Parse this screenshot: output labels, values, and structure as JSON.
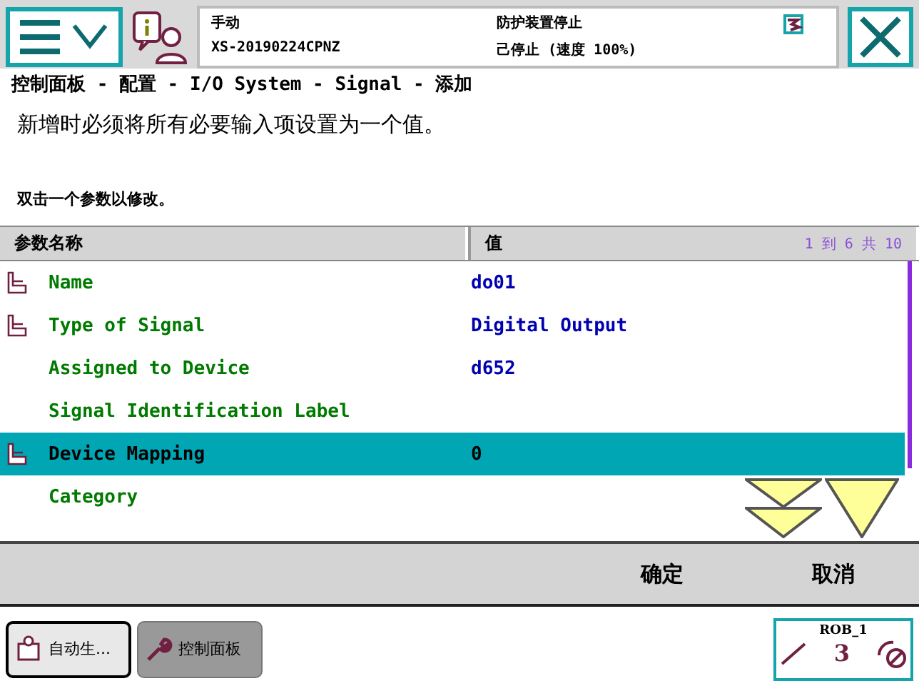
{
  "status": {
    "mode": "手动",
    "system": "XS-20190224CPNZ",
    "safety": "防护装置停止",
    "state": "己停止 (速度 100%)"
  },
  "breadcrumb": "控制面板 - 配置 - I/O System - Signal - 添加",
  "message": "新增时必须将所有必要输入项设置为一个值。",
  "hint": "双击一个参数以修改。",
  "table": {
    "columns": [
      "参数名称",
      "值"
    ],
    "range": "1 到 6 共 10",
    "rows": [
      {
        "name": "Name",
        "value": "do01",
        "required": true,
        "selected": false
      },
      {
        "name": "Type of Signal",
        "value": "Digital Output",
        "required": true,
        "selected": false
      },
      {
        "name": "Assigned to Device",
        "value": "d652",
        "required": false,
        "selected": false
      },
      {
        "name": "Signal Identification Label",
        "required": false,
        "selected": false
      },
      {
        "name": "Device Mapping",
        "value": "0",
        "required": true,
        "selected": true
      },
      {
        "name": "Category",
        "required": false,
        "selected": false
      }
    ]
  },
  "buttons": [
    "确定",
    "取消"
  ],
  "taskbar": [
    {
      "label": "自动生...",
      "selected": true
    },
    {
      "label": "控制面板",
      "selected": false
    }
  ],
  "quickset": {
    "unit": "ROB_1",
    "axes": "3"
  }
}
